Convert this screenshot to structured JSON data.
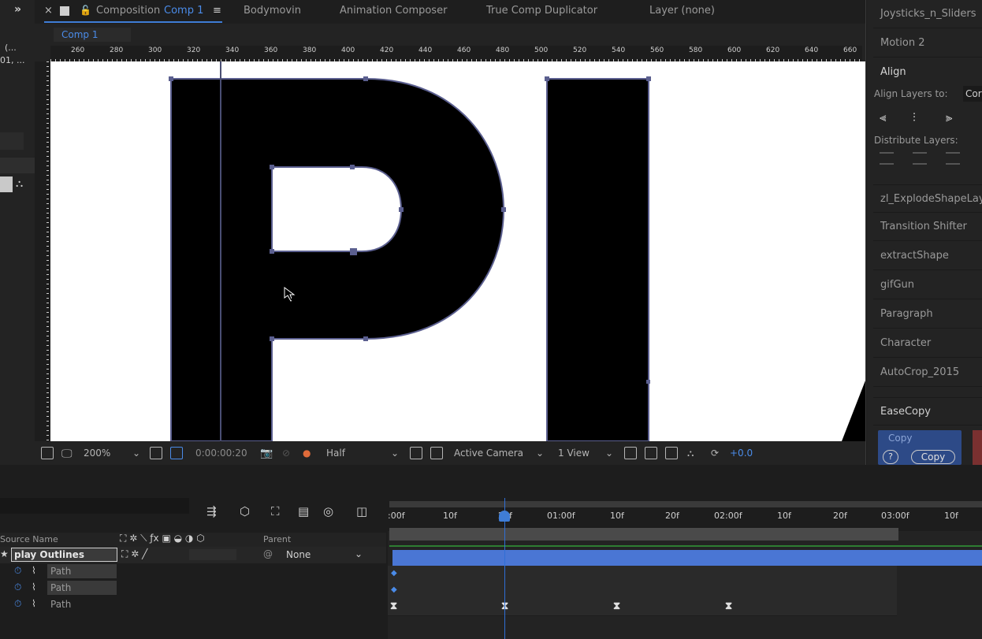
{
  "left": {
    "frag1": "(...",
    "frag2": "01, ..."
  },
  "comp": {
    "tab_prefix": "Composition",
    "tab_name": "Comp 1",
    "tabs": [
      "Bodymovin",
      "Animation Composer",
      "True Comp Duplicator",
      "Layer (none)"
    ],
    "subtab": "Comp 1",
    "ruler_ticks": [
      "260",
      "280",
      "300",
      "320",
      "340",
      "360",
      "380",
      "400",
      "420",
      "440",
      "460",
      "480",
      "500",
      "520",
      "540",
      "560",
      "580",
      "600",
      "620",
      "640",
      "660"
    ],
    "toolbar": {
      "zoom": "200%",
      "timecode": "0:00:00:20",
      "resolution": "Half",
      "camera": "Active Camera",
      "views": "1 View",
      "exposure": "+0.0"
    }
  },
  "right_panel": {
    "items": [
      "Joysticks_n_Sliders",
      "Motion 2"
    ],
    "align": {
      "title": "Align",
      "align_to_label": "Align Layers to:",
      "align_to_value": "Cor",
      "distribute_label": "Distribute Layers:"
    },
    "scripts": [
      "zl_ExplodeShapeLay",
      "Transition Shifter",
      "extractShape",
      "gifGun",
      "Paragraph",
      "Character",
      "AutoCrop_2015"
    ],
    "easecopy": {
      "title": "EaseCopy",
      "copy_label": "Copy",
      "help": "?",
      "copy_button": "Copy"
    }
  },
  "timeline": {
    "columns": {
      "source_name": "Source Name",
      "parent": "Parent"
    },
    "layer": {
      "name": "play Outlines",
      "parent": "None"
    },
    "paths": [
      "Path",
      "Path",
      "Path"
    ],
    "ticks": [
      ":00f",
      "10f",
      "20f",
      "01:00f",
      "10f",
      "20f",
      "02:00f",
      "10f",
      "20f",
      "03:00f",
      "10f"
    ],
    "colors": {
      "accent": "#3f7dd6",
      "bar": "#4a76d4"
    }
  }
}
